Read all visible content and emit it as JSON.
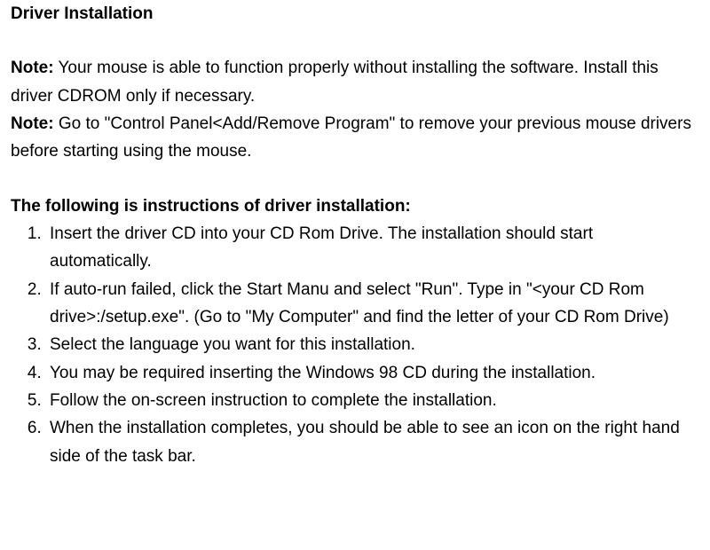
{
  "title": "Driver Installation",
  "notes": {
    "label": "Note:",
    "note1": " Your mouse is able to function properly without installing the software. Install this driver CDROM only if necessary.",
    "note2": " Go to \"Control Panel<Add/Remove Program\" to remove your previous mouse drivers before starting using the mouse."
  },
  "instructions": {
    "heading": "The following is instructions of driver installation:",
    "items": [
      "Insert the driver CD into your CD Rom Drive. The installation should start automatically.",
      "If auto-run failed, click the Start Manu and select \"Run\". Type in \"<your CD Rom drive>:/setup.exe\". (Go to \"My Computer\" and find the letter of your CD Rom Drive)",
      "Select the language you want for this installation.",
      "You may be required inserting the Windows 98 CD during the installation.",
      "Follow the on-screen instruction to complete the installation.",
      "When the installation completes, you should be able to see an icon on the right hand side of the task bar."
    ]
  }
}
